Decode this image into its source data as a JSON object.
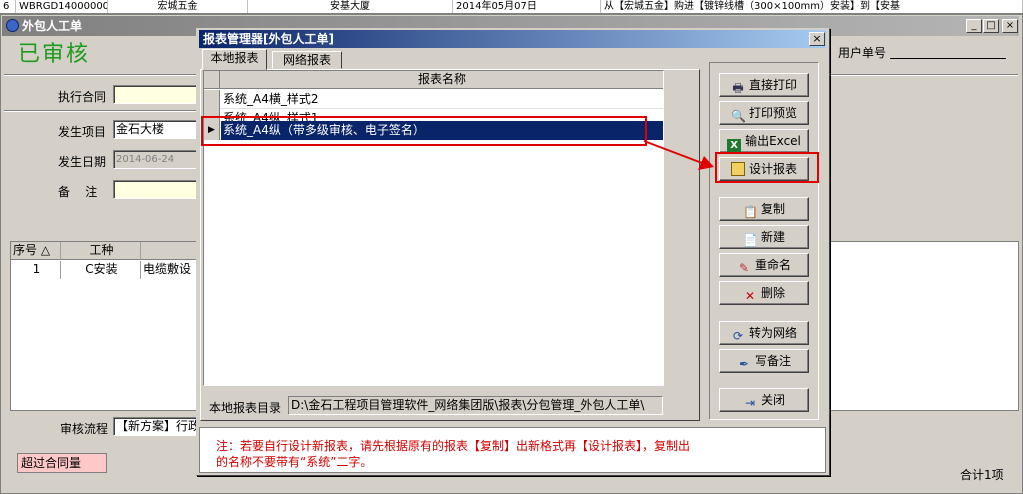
{
  "bg_table_row": [
    "6",
    "WBRGD140000001",
    "宏城五金",
    "安基大厦",
    "2014年05月07日",
    "从【宏城五金】购进【镀锌线槽（300×100mm）安装】到【安基"
  ],
  "outer_window": {
    "title": "外包人工单",
    "status": "已审核",
    "labels": {
      "contract": "执行合同",
      "project": "发生项目",
      "date": "发生日期",
      "remark": "备    注",
      "user_no": "用户单号",
      "workflow": "审核流程"
    },
    "values": {
      "project": "金石大楼",
      "date": "2014-06-24",
      "workflow": "【新方案】行政"
    },
    "grid_headers": [
      "序号",
      "工种"
    ],
    "grid_rows": [
      {
        "no": "1",
        "type": "C安装",
        "desc": "电缆敷设"
      }
    ],
    "over_contract": "超过合同量",
    "total": "合计1项"
  },
  "dialog": {
    "title": "报表管理器[外包人工单]",
    "tabs": [
      "本地报表",
      "网络报表"
    ],
    "column_header": "报表名称",
    "reports": [
      {
        "name": "系统_A4横_样式2",
        "selected": false
      },
      {
        "name": "系统_A4纵_样式1",
        "selected": false
      },
      {
        "name": "系统_A4纵（带多级审核、电子签名）",
        "selected": true
      }
    ],
    "dir_label": "本地报表目录",
    "dir_path": "D:\\金石工程项目管理软件_网络集团版\\报表\\分包管理_外包人工单\\",
    "buttons": {
      "print": "直接打印",
      "preview": "打印预览",
      "excel": "输出Excel",
      "design": "设计报表",
      "copy": "复制",
      "new": "新建",
      "rename": "重命名",
      "delete": "删除",
      "to_network": "转为网络",
      "note": "写备注",
      "close": "关闭"
    },
    "note_line1": "注：若要自行设计新报表，请先根据原有的报表【复制】出新格式再【设计报表】，复制出",
    "note_line2": "的名称不要带有“系统”二字。"
  },
  "colors": {
    "title_active": "#0a246a",
    "title_inactive": "#808080",
    "status_green": "#1d9b1d",
    "annotation_red": "#e00000",
    "note_red": "#d00000"
  }
}
